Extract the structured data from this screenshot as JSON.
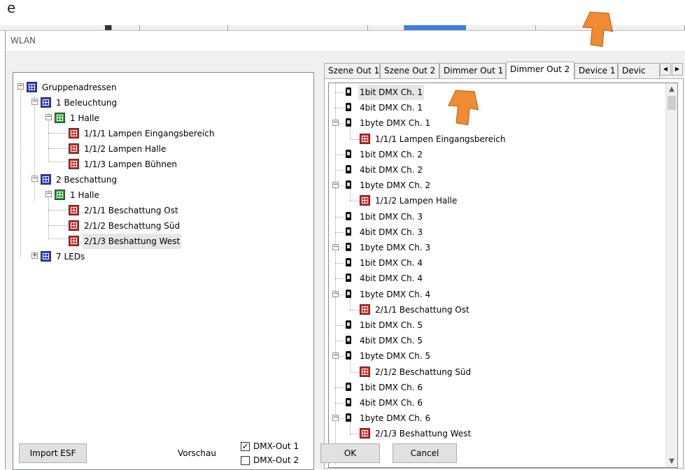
{
  "background": {
    "heading_fragment": "e"
  },
  "window": {
    "title": "WLAN"
  },
  "left_tree": {
    "items": [
      {
        "label": "Gruppenadressen",
        "icon": "blue"
      },
      {
        "label": "1 Beleuchtung",
        "icon": "blue"
      },
      {
        "label": "1 Halle",
        "icon": "green"
      },
      {
        "label": "1/1/1 Lampen Eingangsbereich",
        "icon": "red"
      },
      {
        "label": "1/1/2 Lampen Halle",
        "icon": "red"
      },
      {
        "label": "1/1/3 Lampen Bühnen",
        "icon": "red"
      },
      {
        "label": "2 Beschattung",
        "icon": "blue"
      },
      {
        "label": "1 Halle",
        "icon": "green"
      },
      {
        "label": "2/1/1 Beschattung Ost",
        "icon": "red"
      },
      {
        "label": "2/1/2 Beschattung Süd",
        "icon": "red"
      },
      {
        "label": "2/1/3 Beshattung West",
        "icon": "red",
        "selected": true
      },
      {
        "label": "7 LEDs",
        "icon": "blue"
      }
    ]
  },
  "tabs": [
    {
      "label": "Szene Out 1"
    },
    {
      "label": "Szene Out 2"
    },
    {
      "label": "Dimmer Out 1"
    },
    {
      "label": "Dimmer Out 2",
      "active": true
    },
    {
      "label": "Device 1"
    },
    {
      "label": "Devic"
    }
  ],
  "right_tree": {
    "items": [
      {
        "label": "1bit DMX Ch. 1",
        "icon": "dmx",
        "selected": true
      },
      {
        "label": "4bit DMX Ch. 1",
        "icon": "dmx"
      },
      {
        "label": "1byte DMX Ch. 1",
        "icon": "dmx"
      },
      {
        "label": "1/1/1 Lampen Eingangsbereich",
        "icon": "red"
      },
      {
        "label": "1bit DMX Ch. 2",
        "icon": "dmx"
      },
      {
        "label": "4bit DMX Ch. 2",
        "icon": "dmx"
      },
      {
        "label": "1byte DMX Ch. 2",
        "icon": "dmx"
      },
      {
        "label": "1/1/2 Lampen Halle",
        "icon": "red"
      },
      {
        "label": "1bit DMX Ch. 3",
        "icon": "dmx"
      },
      {
        "label": "4bit DMX Ch. 3",
        "icon": "dmx"
      },
      {
        "label": "1byte DMX Ch. 3",
        "icon": "dmx"
      },
      {
        "label": "1bit DMX Ch. 4",
        "icon": "dmx"
      },
      {
        "label": "4bit DMX Ch. 4",
        "icon": "dmx"
      },
      {
        "label": "1byte DMX Ch. 4",
        "icon": "dmx"
      },
      {
        "label": "2/1/1 Beschattung Ost",
        "icon": "red"
      },
      {
        "label": "1bit DMX Ch. 5",
        "icon": "dmx"
      },
      {
        "label": "4bit DMX Ch. 5",
        "icon": "dmx"
      },
      {
        "label": "1byte DMX Ch. 5",
        "icon": "dmx"
      },
      {
        "label": "2/1/2 Beschattung Süd",
        "icon": "red"
      },
      {
        "label": "1bit DMX Ch. 6",
        "icon": "dmx"
      },
      {
        "label": "4bit DMX Ch. 6",
        "icon": "dmx"
      },
      {
        "label": "1byte DMX Ch. 6",
        "icon": "dmx"
      },
      {
        "label": "2/1/3 Beshattung West",
        "icon": "red"
      }
    ]
  },
  "buttons": {
    "import_esf": "Import ESF",
    "ok": "OK",
    "cancel": "Cancel"
  },
  "preview": {
    "label": "Vorschau",
    "dmx_out_1": {
      "label": "DMX-Out 1",
      "checked": true
    },
    "dmx_out_2": {
      "label": "DMX-Out 2",
      "checked": false
    }
  },
  "colors": {
    "arrow": "#f08a33",
    "ga_blue": "#2b35d8",
    "ga_green": "#1f9e2f",
    "ga_red": "#d82323"
  }
}
